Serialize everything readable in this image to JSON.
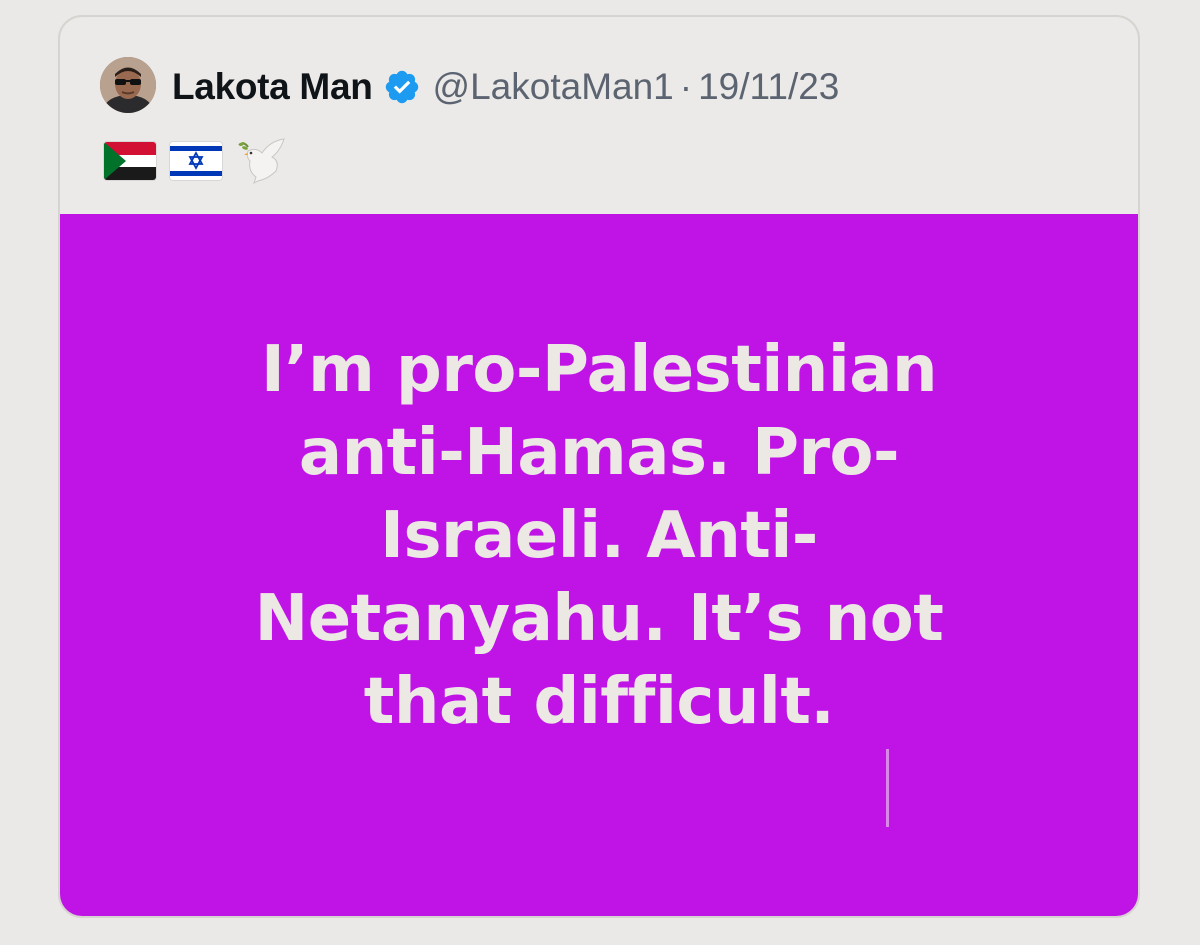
{
  "author": {
    "display_name": "Lakota Man",
    "handle": "@LakotaMan1",
    "separator": "·",
    "date": "19/11/23",
    "verified": true,
    "avatar_icon": "profile-photo"
  },
  "bio_emojis": [
    "sudan-flag-icon",
    "israel-flag-icon",
    "dove-of-peace-icon"
  ],
  "media": {
    "background_color": "#c014e6",
    "text_color": "#ece8e4",
    "lines": [
      "I’m pro-Palestinian",
      "anti-Hamas. Pro-",
      "Israeli. Anti-",
      "Netanyahu. It’s not",
      "that difficult."
    ]
  },
  "colors": {
    "verified_badge": "#1d9bf0",
    "name": "#0f1419",
    "secondary_text": "#5b6470"
  }
}
